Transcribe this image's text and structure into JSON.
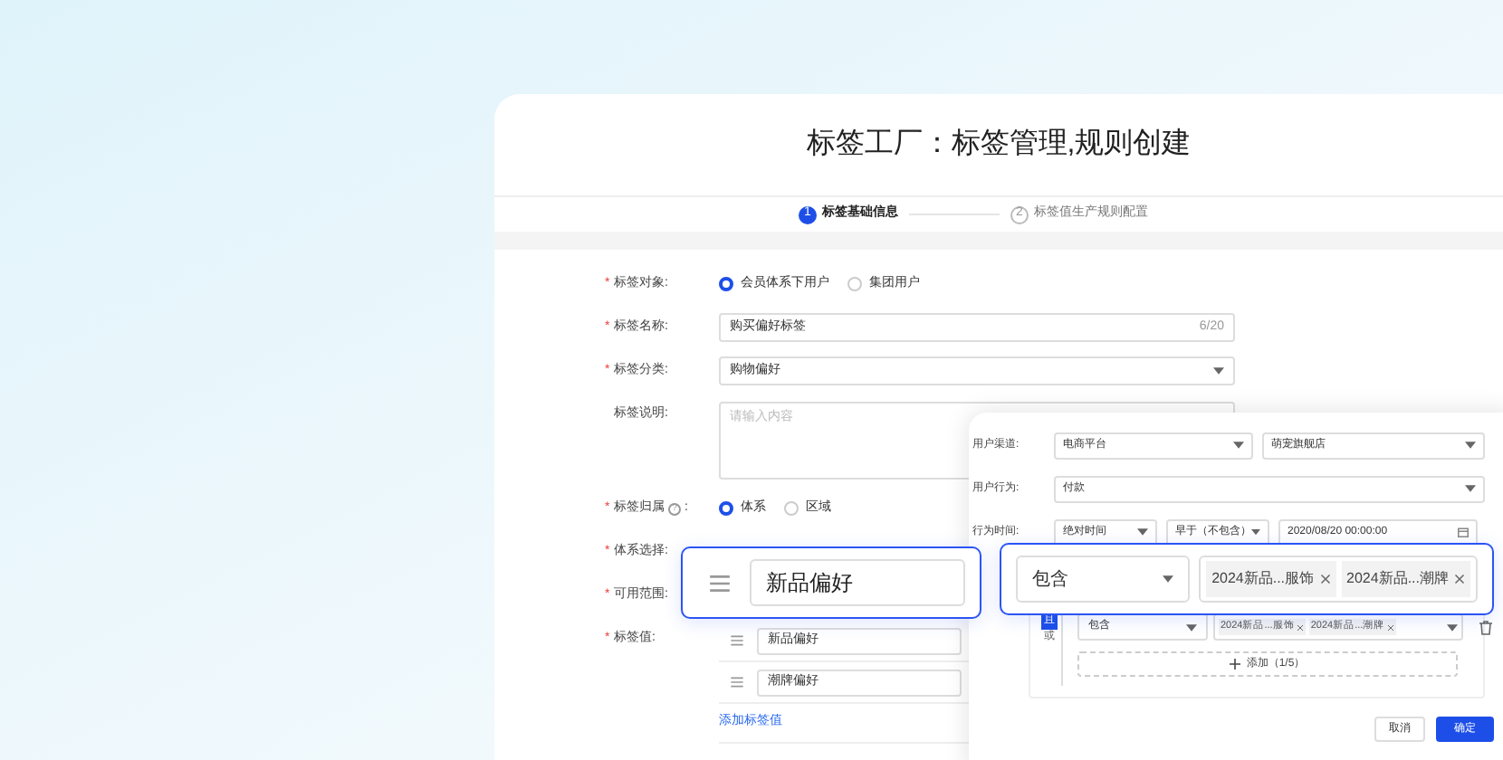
{
  "title": "标签工厂：标签管理,规则创建",
  "steps": [
    {
      "number": "1",
      "label": "标签基础信息",
      "selected": true
    },
    {
      "number": "2",
      "label": "标签值生产规则配置",
      "selected": false
    }
  ],
  "form": [
    {
      "kind": "radio",
      "label": "标签对象:",
      "required_mark": "*",
      "options": [
        {
          "label": "会员体系下用户",
          "selected": true
        },
        {
          "label": "集团用户",
          "selected": false
        }
      ]
    },
    {
      "kind": "input",
      "label": "标签名称:",
      "required_mark": "*",
      "value": "购买偏好标签",
      "count": "6/20"
    },
    {
      "kind": "select",
      "label": "标签分类:",
      "required_mark": "*",
      "value": "购物偏好"
    },
    {
      "kind": "textarea",
      "label": "标签说明:",
      "placeholder": "请输入内容"
    },
    {
      "kind": "radio",
      "label": "标签归属",
      "help": "?",
      "suffix": ":",
      "required_mark": "*",
      "options": [
        {
          "label": "体系",
          "selected": true
        },
        {
          "label": "区域",
          "selected": false
        }
      ]
    },
    {
      "kind": "hidden",
      "label": "体系选择:",
      "required_mark": "*"
    },
    {
      "kind": "hidden",
      "label": "可用范围:",
      "required_mark": "*"
    },
    {
      "kind": "values",
      "label": "标签值:",
      "required_mark": "*",
      "values": [
        "新品偏好",
        "潮牌偏好"
      ],
      "add": "添加标签值"
    }
  ],
  "rule_panel": {
    "channel": {
      "label": "用户渠道:",
      "values": [
        "电商平台",
        "萌宠旗舰店"
      ]
    },
    "behavior": {
      "label": "用户行为:",
      "value": "付款"
    },
    "time": {
      "label": "行为时间:",
      "mode": "绝对时间",
      "compare": "早于（不包含）",
      "date": "2020/08/20 00:00:00"
    },
    "logic": [
      {
        "label": "且",
        "selected": true
      },
      {
        "label": "或",
        "selected": false
      }
    ],
    "condition": {
      "operator": "包含",
      "tags": [
        "2024新品...服饰",
        "2024新品...潮牌"
      ]
    },
    "add": "添加（1/5）",
    "buttons": [
      {
        "label": "取消",
        "primary": false
      },
      {
        "label": "确定",
        "primary": true
      }
    ]
  },
  "callout_value": "新品偏好",
  "callout_condition": {
    "operator": "包含",
    "tags": [
      "2024新品...服饰",
      "2024新品...潮牌"
    ]
  }
}
